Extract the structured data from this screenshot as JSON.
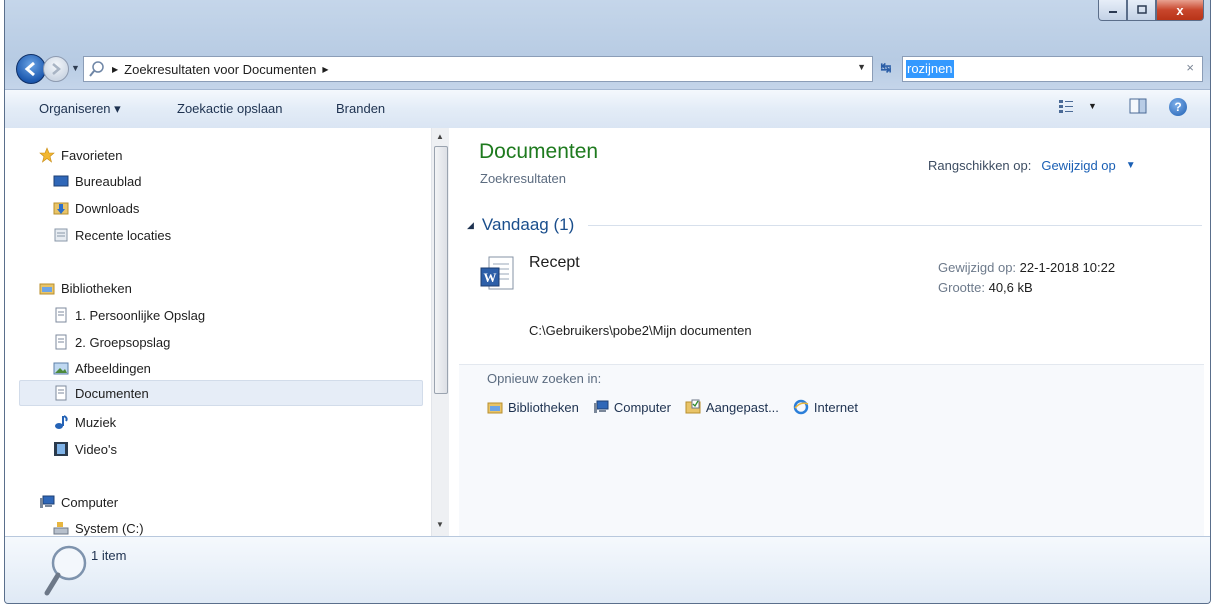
{
  "window": {
    "close_glyph": "x"
  },
  "address_bar": {
    "crumb_label": "Zoekresultaten voor Documenten",
    "separator": "▶",
    "dropdown_glyph": "▼"
  },
  "search": {
    "value": "rozijnen",
    "clear_glyph": "×"
  },
  "toolbar": {
    "organize_label": "Organiseren ▾",
    "save_search_label": "Zoekactie opslaan",
    "burn_label": "Branden",
    "help_glyph": "?"
  },
  "sidebar": {
    "favorites": {
      "header": "Favorieten",
      "items": [
        "Bureaublad",
        "Downloads",
        "Recente locaties"
      ]
    },
    "libraries": {
      "header": "Bibliotheken",
      "items": [
        "1. Persoonlijke Opslag",
        "2. Groepsopslag",
        "Afbeeldingen",
        "Documenten",
        "Muziek",
        "Video's"
      ]
    },
    "computer": {
      "header": "Computer",
      "items": [
        "System (C:)"
      ]
    }
  },
  "main": {
    "title": "Documenten",
    "subtitle": "Zoekresultaten",
    "arrange_label": "Rangschikken op:",
    "arrange_value": "Gewijzigd op",
    "group_header": "Vandaag (1)",
    "result": {
      "name": "Recept",
      "path": "C:\\Gebruikers\\pobe2\\Mijn documenten",
      "modified_label": "Gewijzigd op:",
      "modified_value": "22-1-2018 10:22",
      "size_label": "Grootte:",
      "size_value": "40,6 kB"
    },
    "search_again": {
      "label": "Opnieuw zoeken in:",
      "links": [
        "Bibliotheken",
        "Computer",
        "Aangepast...",
        "Internet"
      ]
    }
  },
  "status_bar": {
    "item_count": "1 item"
  },
  "colors": {
    "title_green": "#1e7a1e",
    "link_blue": "#1a5fb4",
    "annotation_arrow": "#e8170f"
  }
}
